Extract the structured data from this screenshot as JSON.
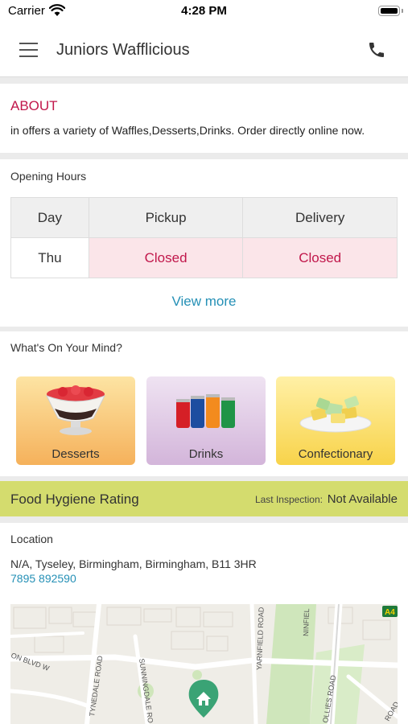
{
  "status_bar": {
    "carrier": "Carrier",
    "time": "4:28 PM"
  },
  "header": {
    "title": "Juniors Wafflicious"
  },
  "about": {
    "title": "ABOUT",
    "text": "in  offers a variety of Waffles,Desserts,Drinks. Order directly online now."
  },
  "hours": {
    "heading": "Opening Hours",
    "columns": [
      "Day",
      "Pickup",
      "Delivery"
    ],
    "rows": [
      {
        "day": "Thu",
        "pickup": "Closed",
        "delivery": "Closed"
      }
    ],
    "view_more": "View more"
  },
  "mind": {
    "heading": "What's On Your Mind?",
    "tiles": [
      {
        "label": "Desserts"
      },
      {
        "label": "Drinks"
      },
      {
        "label": "Confectionary"
      }
    ]
  },
  "hygiene": {
    "title": "Food Hygiene Rating",
    "inspection_label": "Last Inspection:",
    "inspection_value": "Not Available"
  },
  "location": {
    "heading": "Location",
    "address": "N/A, Tyseley, Birmingham, Birmingham, B11 3HR",
    "phone": "7895 892590",
    "map_labels": {
      "road_a": "TYNEDALE ROAD",
      "road_b": "SUNNINGDALE RO",
      "road_c": "YARNFIELD ROAD",
      "road_d": "OLLIES ROAD",
      "road_e": "NINFIEL",
      "road_f": "ROAD",
      "road_g": "ON BLVD W",
      "road_badge": "A4"
    }
  },
  "colors": {
    "accent": "#c1174b",
    "link": "#2590b6",
    "hygiene_bar": "#d4dc6e"
  }
}
